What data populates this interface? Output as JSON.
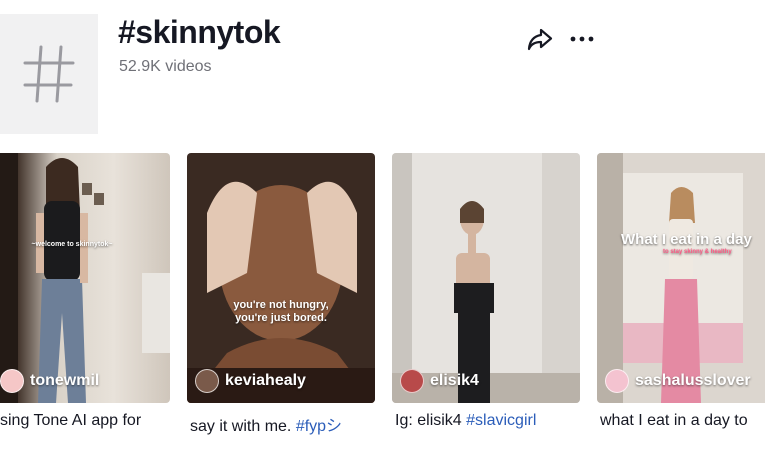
{
  "header": {
    "title": "#skinnytok",
    "video_count": "52.9K videos",
    "hash_icon": "hash-icon",
    "share_icon": "share-icon",
    "more_icon": "more-icon"
  },
  "videos": [
    {
      "author": "tonewmil",
      "overlay": "~welcome to skinnytok~",
      "caption_text": "sing Tone AI app for",
      "caption_tag": ""
    },
    {
      "author": "keviahealy",
      "overlay": "you're not hungry,\nyou're just bored.",
      "caption_text": "say it with me. ",
      "caption_tag": "#fypシ"
    },
    {
      "author": "elisik4",
      "overlay": "",
      "caption_text": "Ig: elisik4 ",
      "caption_tag": "#slavicgirl"
    },
    {
      "author": "sashalusslover",
      "overlay": "What I eat in a day",
      "overlay_sub": "to stay skinny & healthy",
      "caption_text": "what I eat in a day to",
      "caption_tag": ""
    }
  ],
  "colors": {
    "link": "#2b5db9",
    "secondary_text": "#6f7077",
    "thumb_bg": "#f1f1f2"
  }
}
